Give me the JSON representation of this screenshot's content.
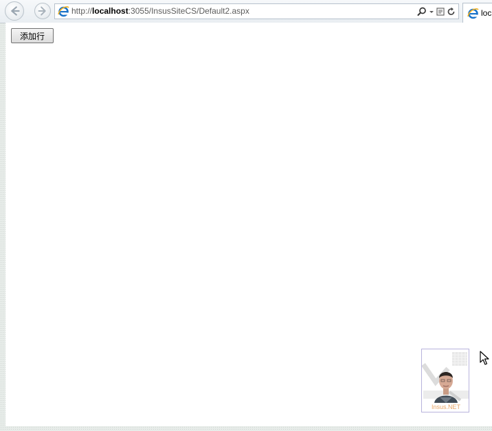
{
  "browser": {
    "address": {
      "url_prefix": "http://",
      "url_host": "localhost",
      "url_rest": ":3055/InsusSiteCS/Default2.aspx"
    },
    "tab": {
      "label": "loc"
    }
  },
  "page": {
    "add_row_button_label": "添加行",
    "logo_text": "Insus.NET"
  },
  "colors": {
    "page_background": "#ffffff",
    "window_frame": "#e7ece9",
    "ie_blue": "#1a73c9",
    "ie_gold": "#f2b01e",
    "logo_border": "#b7b2dc",
    "logo_text": "#e8a566"
  },
  "icons": [
    "back-icon",
    "forward-icon",
    "ie-icon",
    "search-icon",
    "dropdown-icon",
    "compatibility-icon",
    "refresh-icon",
    "cursor-icon"
  ]
}
